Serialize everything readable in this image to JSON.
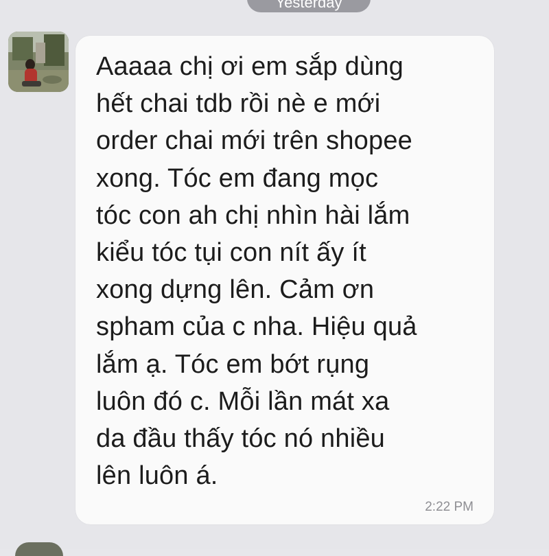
{
  "date_separator": {
    "label": "Yesterday"
  },
  "message": {
    "lines": [
      "Aaaaa chị ơi em sắp dùng",
      "hết chai tdb rồi nè e mới",
      "order chai mới trên shopee",
      "xong. Tóc em đang mọc",
      "tóc con ah chị nhìn hài lắm",
      "kiểu tóc tụi con nít ấy ít",
      "xong dựng lên. Cảm ơn",
      "spham của c nha. Hiệu quả",
      "lắm ạ. Tóc em bớt rụng",
      "luôn đó c. Mỗi lần mát xa",
      "da đầu thấy tóc nó nhiều",
      "lên luôn á."
    ],
    "timestamp": "2:22 PM"
  },
  "colors": {
    "background": "#e6e6ea",
    "bubble": "#fafafa",
    "text": "#1c1c1c",
    "timestamp": "#8e8e93",
    "date_pill": "#9a9aa0"
  },
  "icons": {
    "avatar": "contact-avatar-photo"
  }
}
